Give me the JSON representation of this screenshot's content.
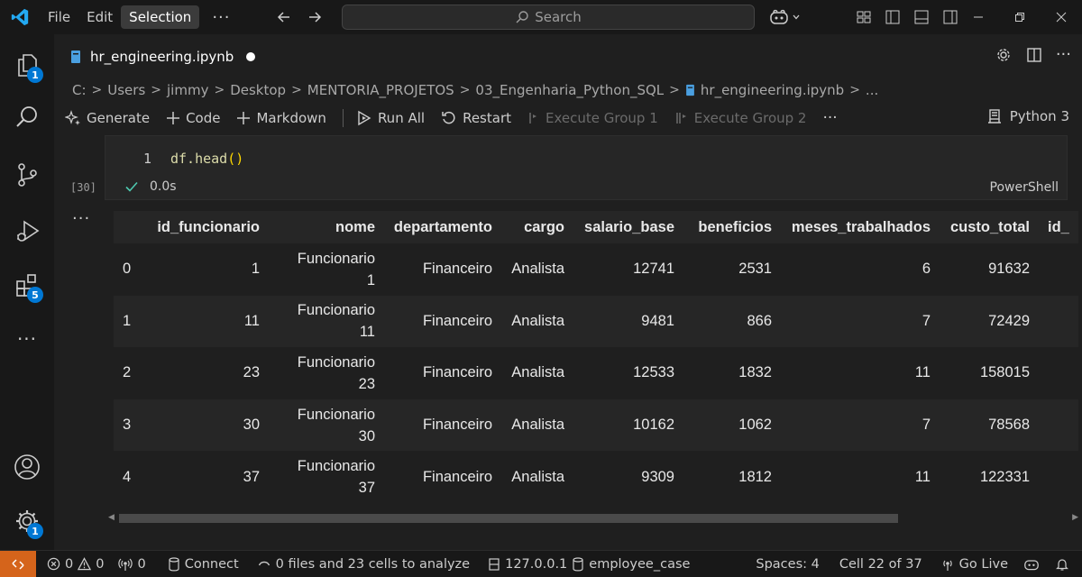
{
  "menu": {
    "file": "File",
    "edit": "Edit",
    "selection": "Selection",
    "more": "···"
  },
  "search": {
    "placeholder": "Search"
  },
  "activity": {
    "explorer_badge": "1",
    "extensions_badge": "5",
    "settings_badge": "1",
    "more": "···"
  },
  "tab": {
    "label": "hr_engineering.ipynb"
  },
  "breadcrumb": [
    "C:",
    "Users",
    "jimmy",
    "Desktop",
    "MENTORIA_PROJETOS",
    "03_Engenharia_Python_SQL",
    "hr_engineering.ipynb",
    "..."
  ],
  "toolbar": {
    "generate": "Generate",
    "code": "Code",
    "markdown": "Markdown",
    "run_all": "Run All",
    "restart": "Restart",
    "exec_group_1": "Execute Group 1",
    "exec_group_2": "Execute Group 2",
    "more": "···",
    "kernel": "Python 3"
  },
  "cell": {
    "line_number": "1",
    "code_fn": "df.head",
    "code_open": "(",
    "code_close": ")",
    "exec_count": "[30]",
    "duration": "0.0s",
    "language": "PowerShell",
    "output_more": "···"
  },
  "table": {
    "columns": [
      "",
      "id_funcionario",
      "nome",
      "departamento",
      "cargo",
      "salario_base",
      "beneficios",
      "meses_trabalhados",
      "custo_total",
      "id_"
    ],
    "rows": [
      [
        "0",
        "1",
        "Funcionario",
        "1",
        "Financeiro",
        "Analista",
        "12741",
        "2531",
        "6",
        "91632"
      ],
      [
        "1",
        "11",
        "Funcionario",
        "11",
        "Financeiro",
        "Analista",
        "9481",
        "866",
        "7",
        "72429"
      ],
      [
        "2",
        "23",
        "Funcionario",
        "23",
        "Financeiro",
        "Analista",
        "12533",
        "1832",
        "11",
        "158015"
      ],
      [
        "3",
        "30",
        "Funcionario",
        "30",
        "Financeiro",
        "Analista",
        "10162",
        "1062",
        "7",
        "78568"
      ],
      [
        "4",
        "37",
        "Funcionario",
        "37",
        "Financeiro",
        "Analista",
        "9309",
        "1812",
        "11",
        "122331"
      ]
    ]
  },
  "status": {
    "errors": "0",
    "warnings": "0",
    "ports": "0",
    "connect": "Connect",
    "analyze": "0 files and 23 cells to analyze",
    "server": "127.0.0.1",
    "database": "employee_case",
    "spaces": "Spaces: 4",
    "cell_pos": "Cell 22 of 37",
    "go_live": "Go Live"
  },
  "colors": {
    "accent": "#0078d4",
    "remote": "#d5641b",
    "success": "#4ec9b0"
  }
}
